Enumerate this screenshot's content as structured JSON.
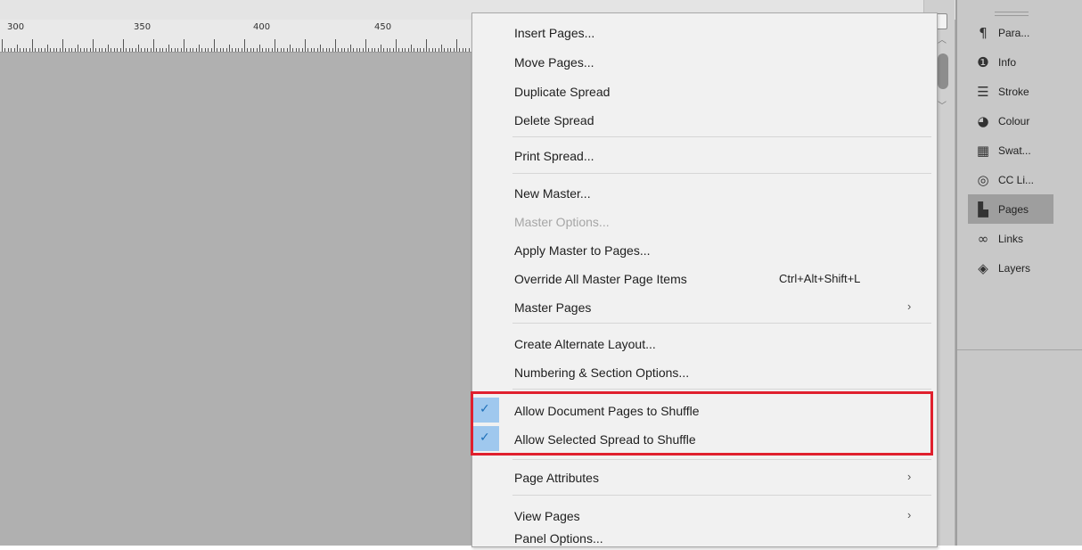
{
  "ruler": {
    "numbers": [
      "300",
      "350",
      "400",
      "450"
    ]
  },
  "menu": {
    "items": [
      {
        "label": "Insert Pages..."
      },
      {
        "label": "Move Pages..."
      },
      {
        "label": "Duplicate Spread"
      },
      {
        "label": "Delete Spread"
      },
      {
        "label": "Print Spread..."
      },
      {
        "label": "New Master..."
      },
      {
        "label": "Master Options..."
      },
      {
        "label": "Apply Master to Pages..."
      },
      {
        "label": "Override All Master Page Items",
        "shortcut": "Ctrl+Alt+Shift+L"
      },
      {
        "label": "Master Pages",
        "submenu": "›"
      },
      {
        "label": "Create Alternate Layout..."
      },
      {
        "label": "Numbering & Section Options..."
      },
      {
        "label": "Allow Document Pages to Shuffle",
        "checked": true
      },
      {
        "label": "Allow Selected Spread to Shuffle",
        "checked": true
      },
      {
        "label": "Page Attributes",
        "submenu": "›"
      },
      {
        "label": "View Pages",
        "submenu": "›"
      },
      {
        "label": "Panel Options..."
      }
    ],
    "check_glyph": "✓"
  },
  "scrollbar": {
    "up_glyph": "︿",
    "down_glyph": "﹀"
  },
  "panel": {
    "items": [
      {
        "label": "Para...",
        "icon": "paragraph-icon",
        "glyph": "¶"
      },
      {
        "label": "Info",
        "icon": "info-icon",
        "glyph": "❶"
      },
      {
        "label": "Stroke",
        "icon": "stroke-icon",
        "glyph": "☰"
      },
      {
        "label": "Colour",
        "icon": "colour-icon",
        "glyph": "◕"
      },
      {
        "label": "Swat...",
        "icon": "swatches-icon",
        "glyph": "▦"
      },
      {
        "label": "CC Li...",
        "icon": "cc-libraries-icon",
        "glyph": "◎"
      },
      {
        "label": "Pages",
        "icon": "pages-icon",
        "glyph": "▙",
        "active": true
      },
      {
        "label": "Links",
        "icon": "links-icon",
        "glyph": "∞"
      },
      {
        "label": "Layers",
        "icon": "layers-icon",
        "glyph": "◈"
      }
    ]
  },
  "colors": {
    "highlight_border": "#e0202e",
    "check_column": "#9fc8ee",
    "menu_background": "#f1f1f1"
  }
}
